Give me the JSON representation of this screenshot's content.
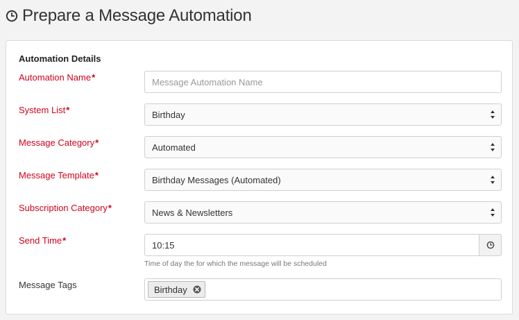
{
  "header": {
    "title": "Prepare a Message Automation",
    "icon": "clock-icon"
  },
  "form": {
    "section_title": "Automation Details",
    "required_marker": "*",
    "automation_name": {
      "label": "Automation Name",
      "value": "",
      "placeholder": "Message Automation Name"
    },
    "system_list": {
      "label": "System List",
      "selected": "Birthday"
    },
    "message_category": {
      "label": "Message Category",
      "selected": "Automated"
    },
    "message_template": {
      "label": "Message Template",
      "selected": "Birthday Messages (Automated)"
    },
    "subscription_category": {
      "label": "Subscription Category",
      "selected": "News & Newsletters"
    },
    "send_time": {
      "label": "Send Time",
      "value": "10:15",
      "help": "Time of day the for which the message will be scheduled"
    },
    "message_tags": {
      "label": "Message Tags",
      "tags": [
        "Birthday"
      ]
    }
  },
  "colors": {
    "required_label": "#d0021b",
    "page_background": "#f3f3f3",
    "panel_background": "#ffffff"
  }
}
